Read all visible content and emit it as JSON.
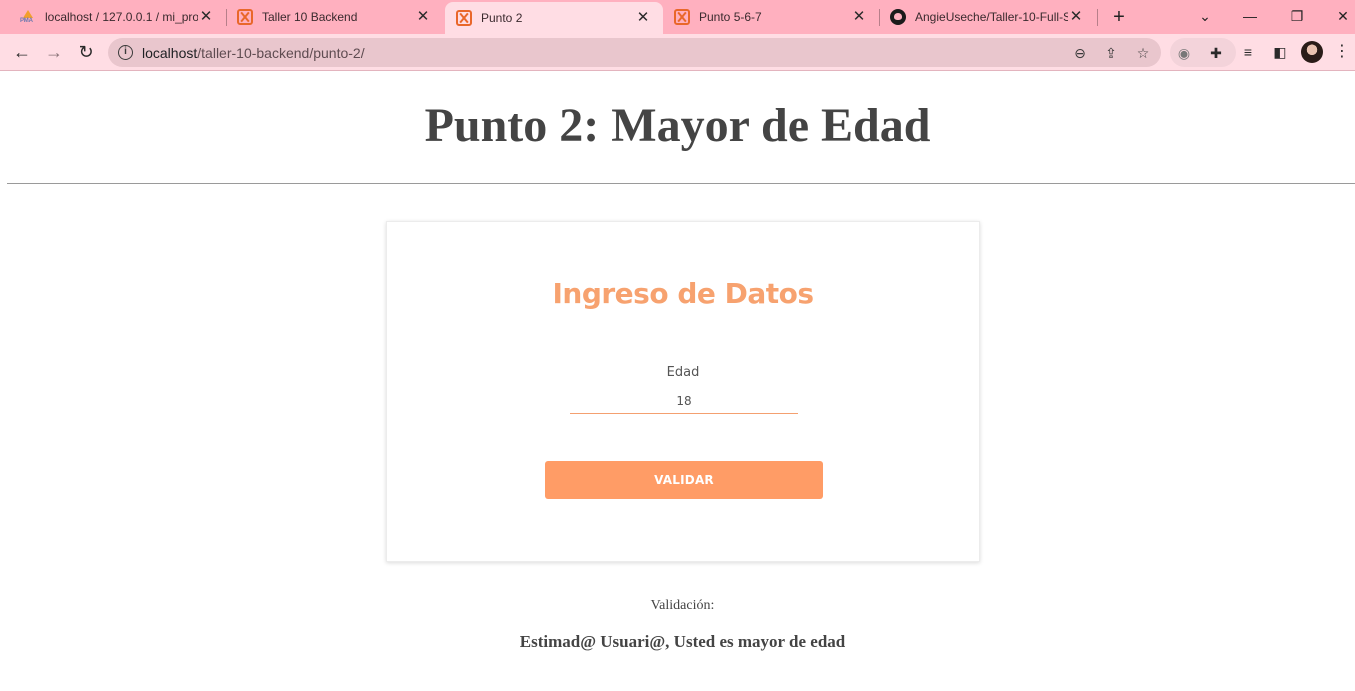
{
  "browser": {
    "tabs": [
      {
        "label": "localhost / 127.0.0.1 / mi_pro",
        "icon": "phpmyadmin-icon",
        "active": false
      },
      {
        "label": "Taller 10 Backend",
        "icon": "xampp-icon",
        "active": false
      },
      {
        "label": "Punto 2",
        "icon": "xampp-icon",
        "active": true
      },
      {
        "label": "Punto 5-6-7",
        "icon": "xampp-icon",
        "active": false
      },
      {
        "label": "AngieUseche/Taller-10-Full-S",
        "icon": "github-icon",
        "active": false
      }
    ],
    "pma_icon_text": "PMA",
    "close_glyph": "✕",
    "new_tab_glyph": "+",
    "address": {
      "host": "localhost",
      "path": "/taller-10-backend/punto-2/"
    },
    "accent_color": "#ffb0bf"
  },
  "page": {
    "title": "Punto 2: Mayor de Edad"
  },
  "form": {
    "title": "Ingreso de Datos",
    "field_label": "Edad",
    "field_value": "18",
    "submit_label": "VALIDAR",
    "accent_color": "#ff9c66"
  },
  "result": {
    "label": "Validación:",
    "message": "Estimad@ Usuari@, Usted es mayor de edad"
  }
}
